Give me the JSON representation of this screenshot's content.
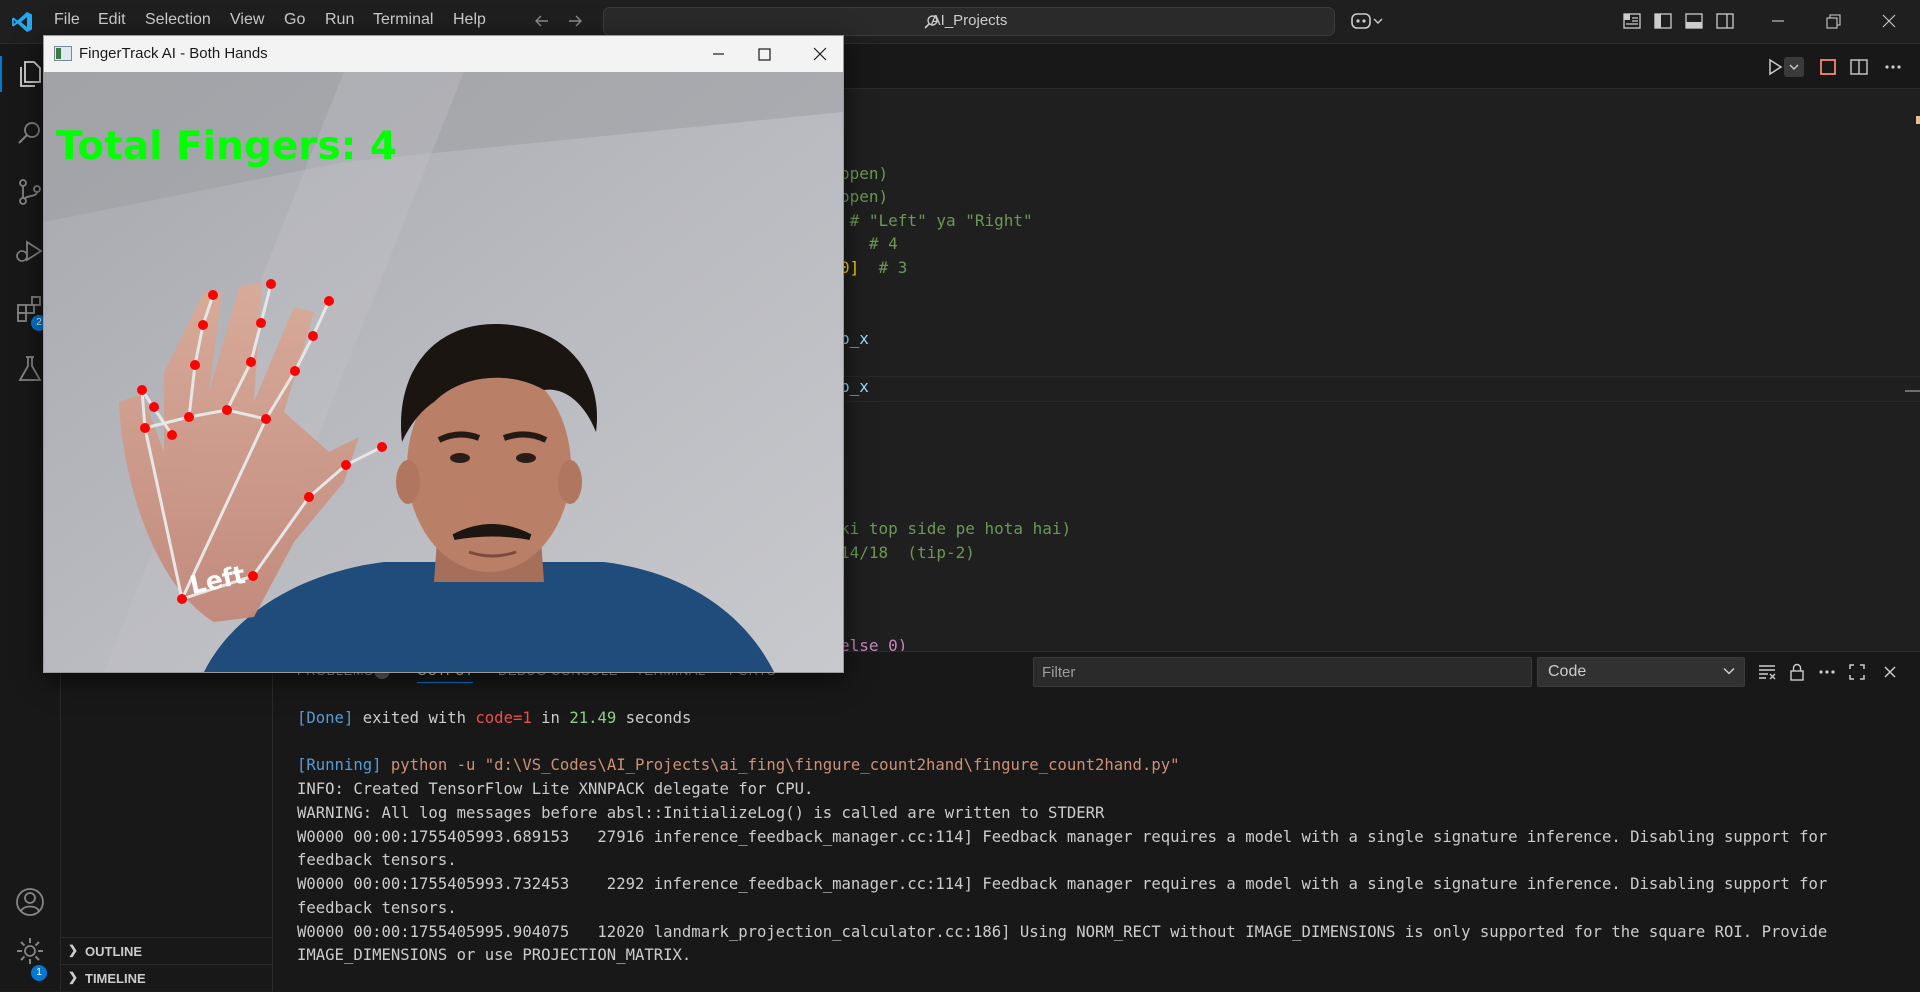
{
  "menu": {
    "items": [
      "File",
      "Edit",
      "Selection",
      "View",
      "Go",
      "Run",
      "Terminal",
      "Help"
    ]
  },
  "command_center": {
    "text": "AI_Projects"
  },
  "activity": {
    "extensions_badge": "2",
    "settings_badge": "1"
  },
  "sidebar": {
    "outline_label": "OUTLINE",
    "timeline_label": "TIMELINE"
  },
  "editor": {
    "lines": [
      {
        "text": "open)"
      },
      {
        "text": "open)"
      },
      {
        "text": " # \"Left\" ya \"Right\""
      },
      {
        "text": "   # 4"
      },
      {
        "bracket": "0]",
        "text": "  # 3"
      },
      {
        "text": "p_x"
      },
      {
        "text": "p_x"
      },
      {
        "text": "ki top side pe hota hai)"
      },
      {
        "text": "14/18  (tip-2)"
      },
      {
        "text": "else 0)"
      }
    ]
  },
  "panel": {
    "tabs": [
      "PROBLEMS",
      "OUTPUT",
      "DEBUG CONSOLE",
      "TERMINAL",
      "PORTS"
    ],
    "problems_badge": "2",
    "filter_placeholder": "Filter",
    "channel_select": "Code",
    "output": {
      "done_tag": "[Done]",
      "done_text1": " exited with ",
      "done_code": "code=1",
      "done_text2": " in ",
      "done_time": "21.49",
      "done_text3": " seconds",
      "running_tag": "[Running]",
      "running_cmd": " python -u \"d:\\VS_Codes\\AI_Projects\\ai_fing\\fingure_count2hand\\fingure_count2hand.py\"",
      "lines": [
        "INFO: Created TensorFlow Lite XNNPACK delegate for CPU.",
        "WARNING: All log messages before absl::InitializeLog() is called are written to STDERR",
        "W0000 00:00:1755405993.689153   27916 inference_feedback_manager.cc:114] Feedback manager requires a model with a single signature inference. Disabling support for",
        "feedback tensors.",
        "W0000 00:00:1755405993.732453    2292 inference_feedback_manager.cc:114] Feedback manager requires a model with a single signature inference. Disabling support for",
        "feedback tensors.",
        "W0000 00:00:1755405995.904075   12020 landmark_projection_calculator.cc:186] Using NORM_RECT without IMAGE_DIMENSIONS is only supported for the square ROI. Provide",
        "IMAGE_DIMENSIONS or use PROJECTION_MATRIX."
      ]
    }
  },
  "camera_window": {
    "title": "FingerTrack AI - Both Hands",
    "overlay_text": "Total Fingers: 4",
    "hand_label": "Left"
  },
  "colors": {
    "accent": "#0078d4",
    "overlay_green": "#00ff00",
    "landmark_red": "#ff0000",
    "connector_white": "#e6e6e6"
  }
}
